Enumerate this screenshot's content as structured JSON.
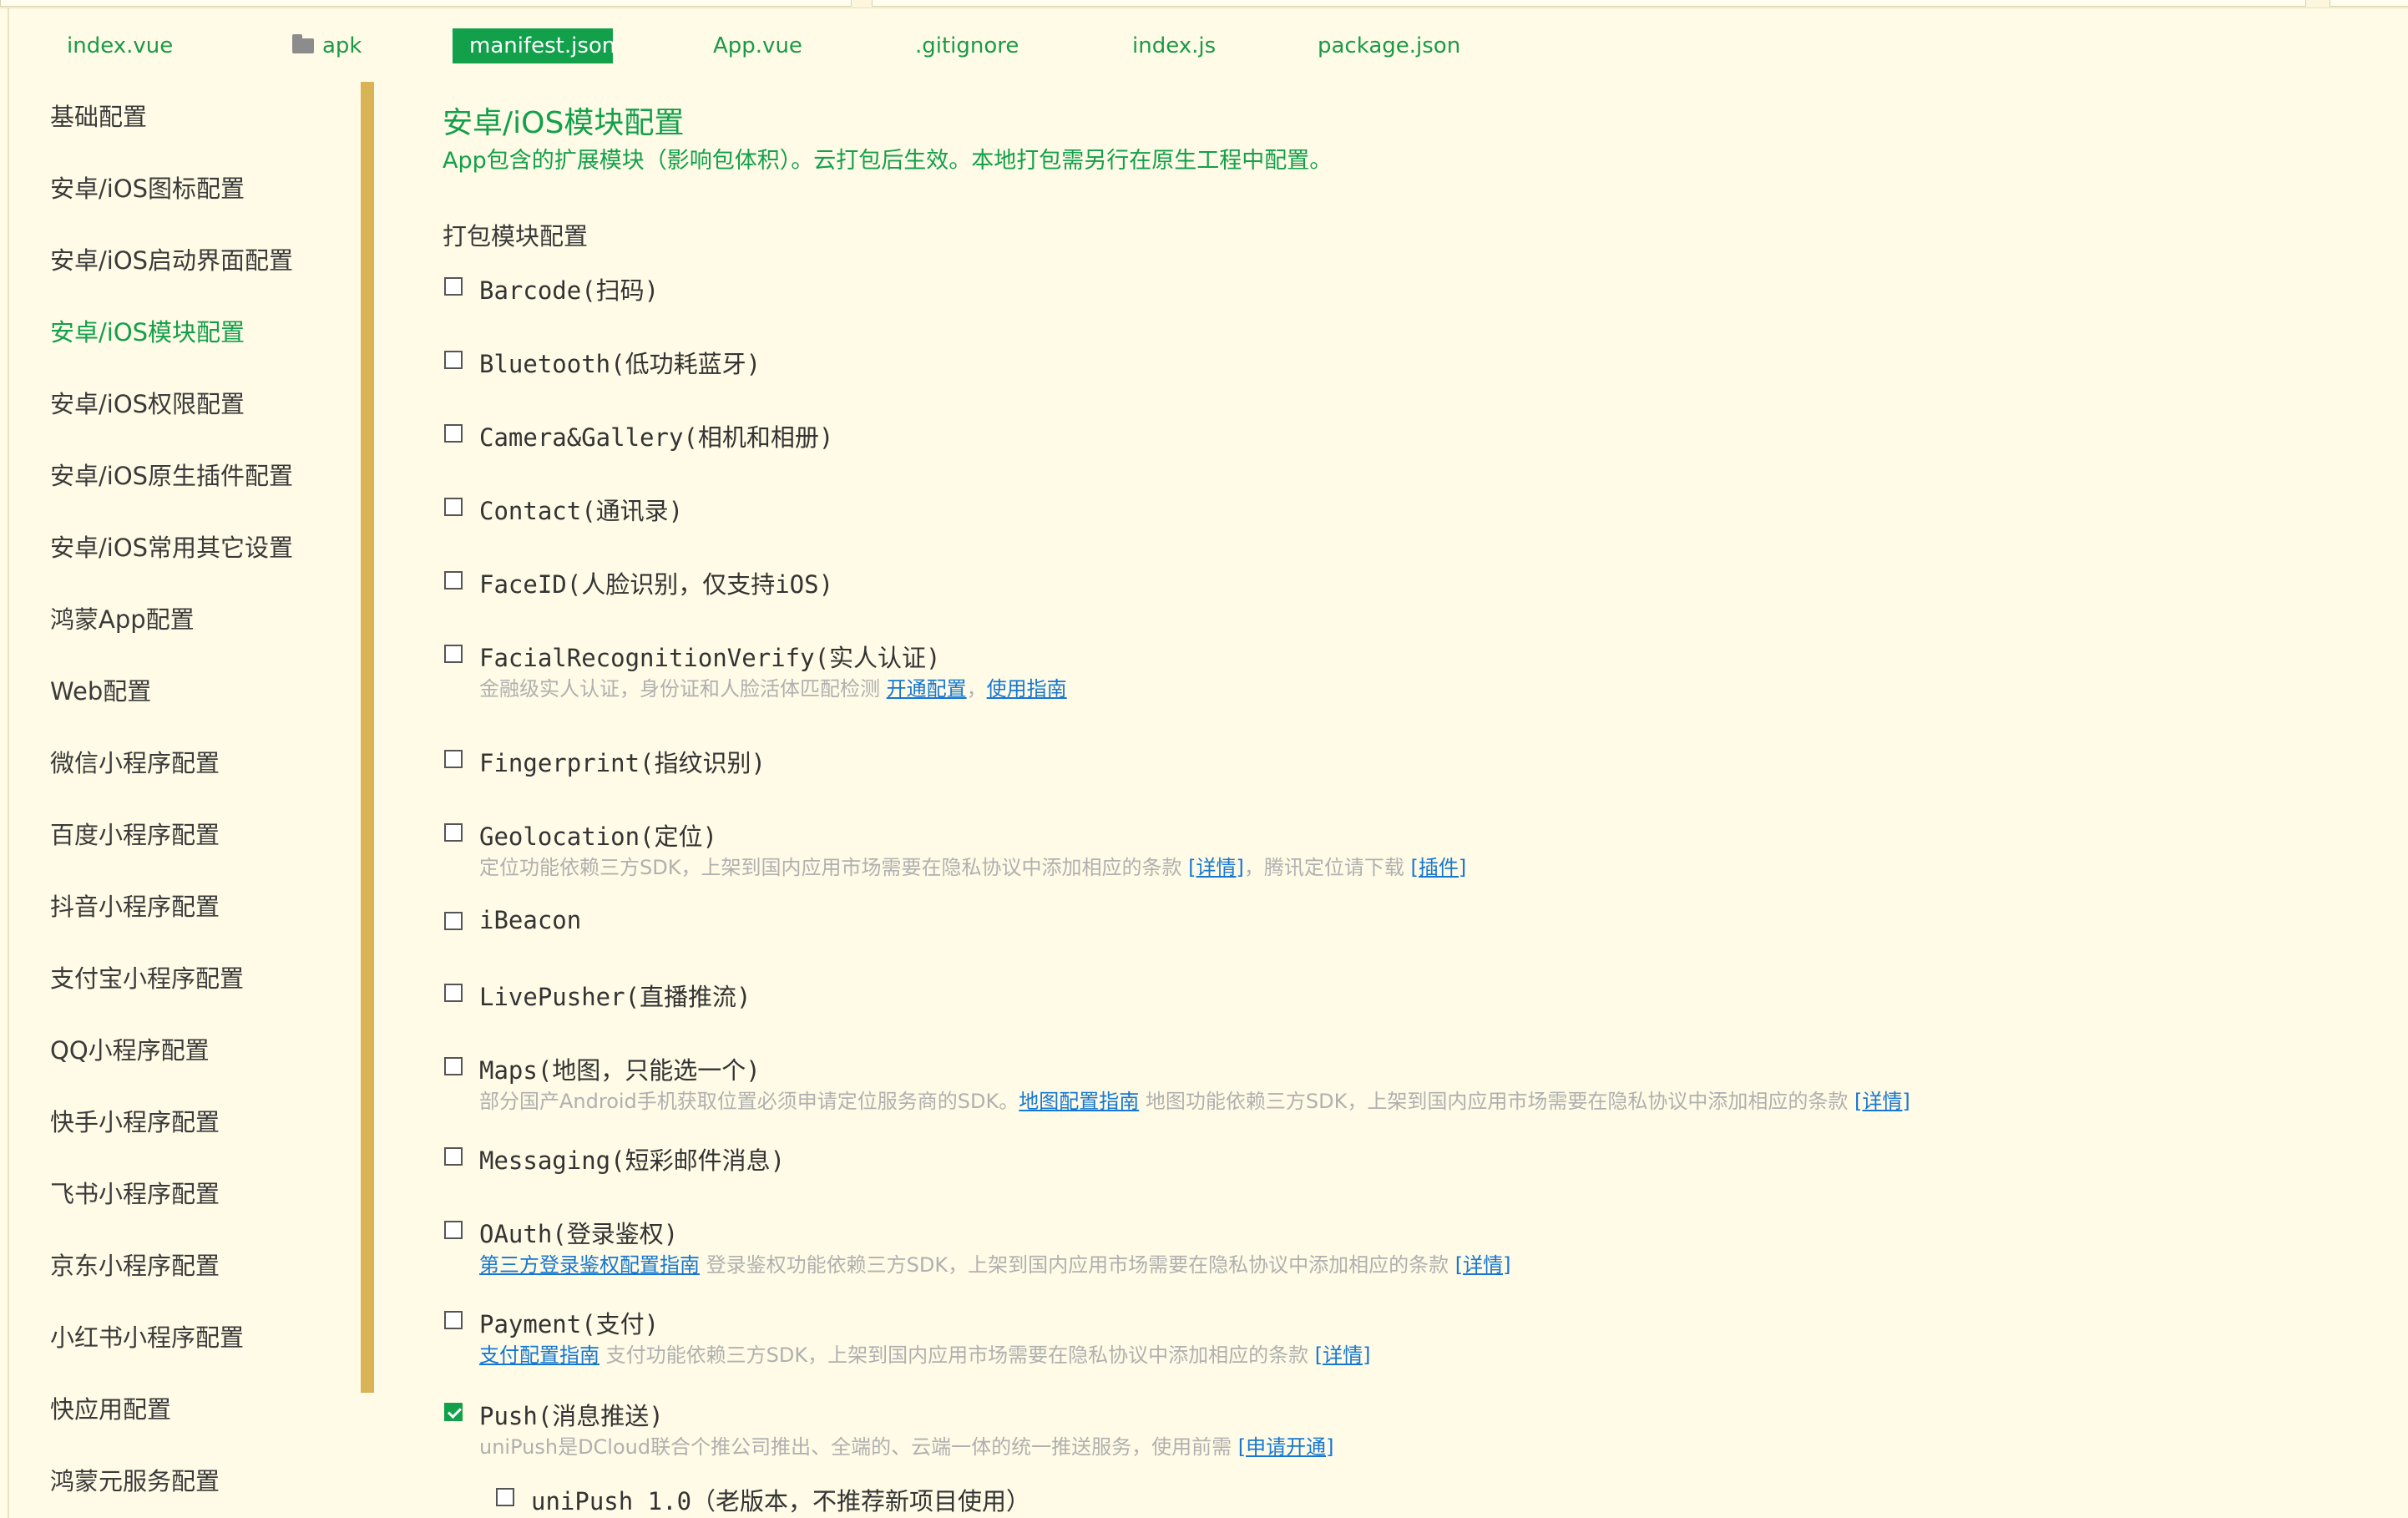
{
  "tabs": [
    {
      "label": "index.vue"
    },
    {
      "label": "apk",
      "icon": "folder-icon"
    },
    {
      "label": "manifest.json",
      "active": true
    },
    {
      "label": "App.vue"
    },
    {
      "label": ".gitignore"
    },
    {
      "label": "index.js"
    },
    {
      "label": "package.json"
    }
  ],
  "sidebar": {
    "items": [
      {
        "label": "基础配置"
      },
      {
        "label": "安卓/iOS图标配置"
      },
      {
        "label": "安卓/iOS启动界面配置"
      },
      {
        "label": "安卓/iOS模块配置",
        "active": true
      },
      {
        "label": "安卓/iOS权限配置"
      },
      {
        "label": "安卓/iOS原生插件配置"
      },
      {
        "label": "安卓/iOS常用其它设置"
      },
      {
        "label": "鸿蒙App配置"
      },
      {
        "label": "Web配置"
      },
      {
        "label": "微信小程序配置"
      },
      {
        "label": "百度小程序配置"
      },
      {
        "label": "抖音小程序配置"
      },
      {
        "label": "支付宝小程序配置"
      },
      {
        "label": "QQ小程序配置"
      },
      {
        "label": "快手小程序配置"
      },
      {
        "label": "飞书小程序配置"
      },
      {
        "label": "京东小程序配置"
      },
      {
        "label": "小红书小程序配置"
      },
      {
        "label": "快应用配置"
      },
      {
        "label": "鸿蒙元服务配置"
      }
    ]
  },
  "main": {
    "title": "安卓/iOS模块配置",
    "description": "App包含的扩展模块（影响包体积）。云打包后生效。本地打包需另行在原生工程中配置。",
    "group_title": "打包模块配置",
    "modules": [
      {
        "label": "Barcode(扫码)",
        "checked": false
      },
      {
        "label": "Bluetooth(低功耗蓝牙)",
        "checked": false
      },
      {
        "label": "Camera&Gallery(相机和相册)",
        "checked": false
      },
      {
        "label": "Contact(通讯录)",
        "checked": false
      },
      {
        "label": "FaceID(人脸识别，仅支持iOS)",
        "checked": false
      },
      {
        "label": "FacialRecognitionVerify(实人认证)",
        "checked": false,
        "desc": [
          {
            "text": "金融级实人认证，身份证和人脸活体匹配检测 "
          },
          {
            "text": "开通配置",
            "link": true
          },
          {
            "text": "，"
          },
          {
            "text": "使用指南",
            "link": true
          }
        ]
      },
      {
        "label": "Fingerprint(指纹识别)",
        "checked": false
      },
      {
        "label": "Geolocation(定位)",
        "checked": false,
        "desc": [
          {
            "text": "定位功能依赖三方SDK，上架到国内应用市场需要在隐私协议中添加相应的条款 "
          },
          {
            "text": "[详情]",
            "link": true
          },
          {
            "text": "，腾讯定位请下载 "
          },
          {
            "text": "[插件]",
            "link": true
          }
        ]
      },
      {
        "label": "iBeacon",
        "checked": false
      },
      {
        "label": "LivePusher(直播推流)",
        "checked": false
      },
      {
        "label": "Maps(地图，只能选一个)",
        "checked": false,
        "desc": [
          {
            "text": "部分国产Android手机获取位置必须申请定位服务商的SDK。"
          },
          {
            "text": "地图配置指南",
            "link": true
          },
          {
            "text": " 地图功能依赖三方SDK，上架到国内应用市场需要在隐私协议中添加相应的条款 "
          },
          {
            "text": "[详情]",
            "link": true
          }
        ]
      },
      {
        "label": "Messaging(短彩邮件消息)",
        "checked": false
      },
      {
        "label": "OAuth(登录鉴权)",
        "checked": false,
        "desc": [
          {
            "text": "第三方登录鉴权配置指南",
            "link": true
          },
          {
            "text": " 登录鉴权功能依赖三方SDK，上架到国内应用市场需要在隐私协议中添加相应的条款 "
          },
          {
            "text": "[详情]",
            "link": true
          }
        ]
      },
      {
        "label": "Payment(支付)",
        "checked": false,
        "desc": [
          {
            "text": "支付配置指南",
            "link": true
          },
          {
            "text": " 支付功能依赖三方SDK，上架到国内应用市场需要在隐私协议中添加相应的条款 "
          },
          {
            "text": "[详情]",
            "link": true
          }
        ]
      },
      {
        "label": "Push(消息推送)",
        "checked": true,
        "desc": [
          {
            "text": "uniPush是DCloud联合个推公司推出、全端的、云端一体的统一推送服务，使用前需 "
          },
          {
            "text": "[申请开通]",
            "link": true
          }
        ]
      }
    ],
    "sub_modules": [
      {
        "label": "uniPush 1.0（老版本，不推荐新项目使用）",
        "checked": false
      }
    ]
  },
  "colors": {
    "accent": "#12a04b",
    "link": "#1677d2",
    "background": "#fffbe6",
    "scrollbar": "#d8b454"
  }
}
